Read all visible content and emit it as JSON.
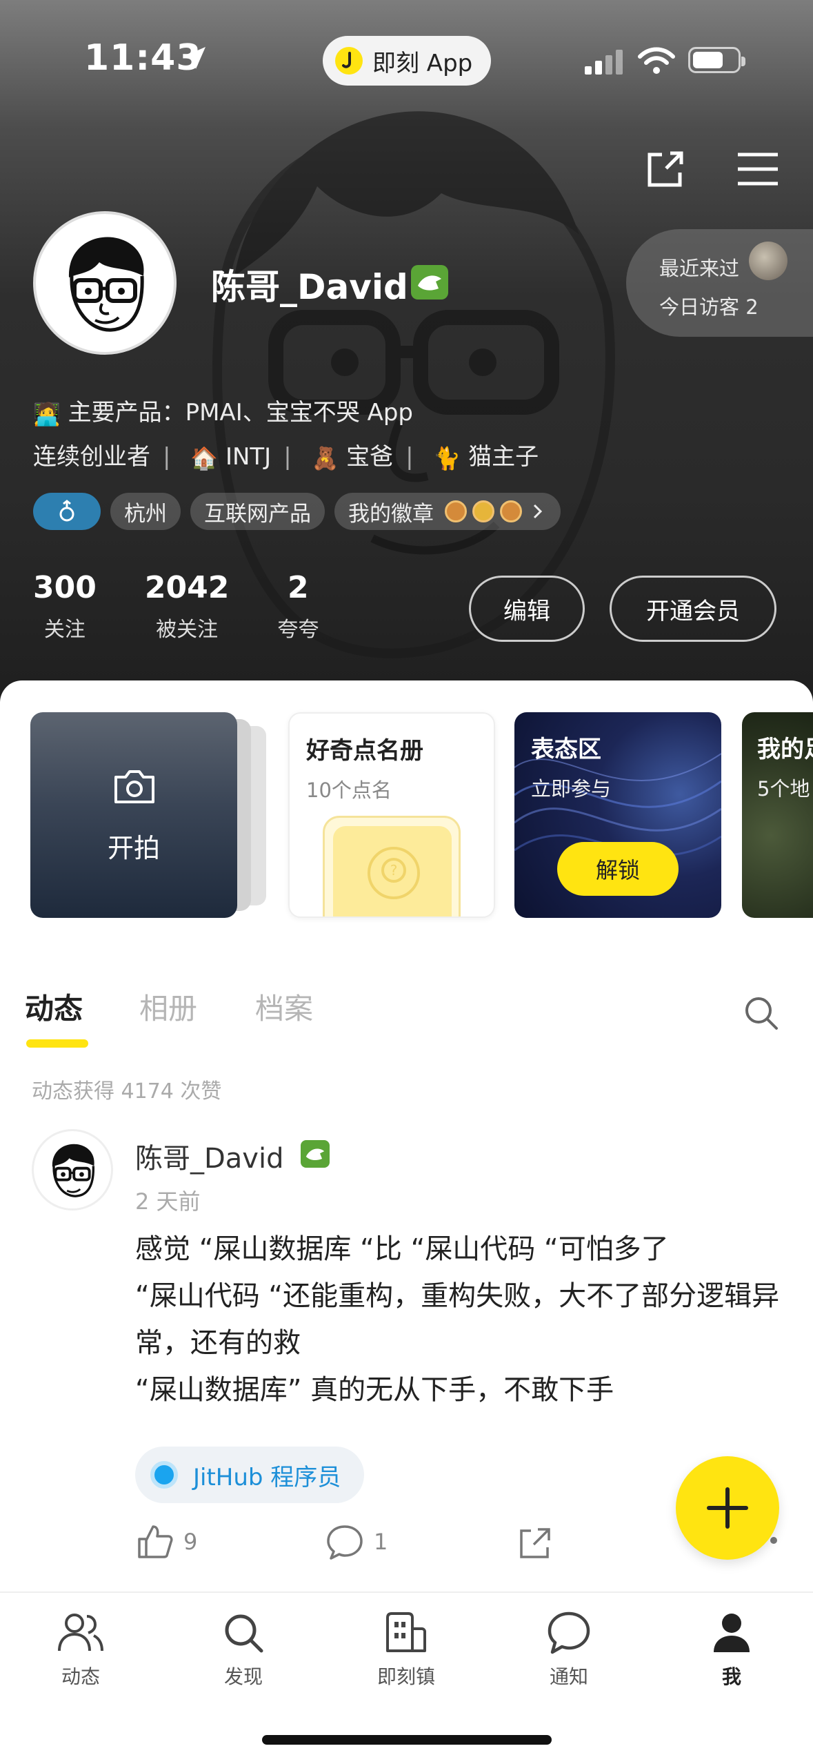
{
  "status_bar": {
    "time": "11:43",
    "app_pill": "即刻 App"
  },
  "profile": {
    "username": "陈哥_David",
    "visitors": {
      "recent_label": "最近来过",
      "today_label": "今日访客 2"
    },
    "bio_line1": "主要产品：PMAI、宝宝不哭 App",
    "bio_line2": [
      "连续创业者",
      "INTJ",
      "宝爸",
      "猫主子"
    ],
    "chips": [
      "杭州",
      "互联网产品",
      "我的徽章"
    ],
    "stats": [
      {
        "num": "300",
        "label": "关注"
      },
      {
        "num": "2042",
        "label": "被关注"
      },
      {
        "num": "2",
        "label": "夸夸"
      }
    ],
    "edit_label": "编辑",
    "vip_label": "开通会员"
  },
  "cards": {
    "shoot_label": "开拍",
    "curious_title": "好奇点名册",
    "curious_sub": "10个点名",
    "attitude_title": "表态区",
    "attitude_sub": "立即参与",
    "unlock_label": "解锁",
    "map_title": "我的足",
    "map_sub": "5个地"
  },
  "tabs": [
    "动态",
    "相册",
    "档案"
  ],
  "likes_total": "动态获得 4174 次赞",
  "post": {
    "author": "陈哥_David",
    "time": "2 天前",
    "text": "感觉 “屎山数据库 “比 “屎山代码 “可怕多了\n“屎山代码 “还能重构，重构失败，大不了部分逻辑异常，还有的救\n“屎山数据库” 真的无从下手，不敢下手",
    "topic": "JitHub 程序员",
    "likes": "9",
    "comments": "1"
  },
  "tabbar": [
    "动态",
    "发现",
    "即刻镇",
    "通知",
    "我"
  ],
  "colors": {
    "accent": "#ffe411",
    "verified": "#5aa536",
    "topic": "#1c8fd8"
  }
}
